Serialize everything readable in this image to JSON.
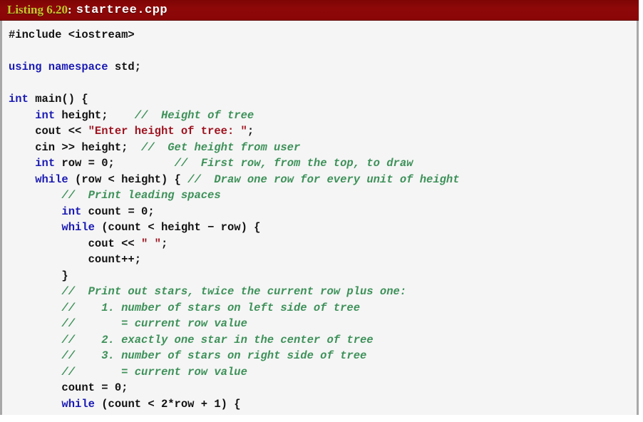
{
  "caption": {
    "listing_number": "Listing 6.20",
    "separator": ":",
    "filename": "startree.cpp"
  },
  "colors": {
    "caption_background": "#8a0707",
    "caption_listing_number": "#c6c82c",
    "caption_filename": "#ffffff",
    "code_background": "#f5f5f5",
    "keyword": "#1a1ab4",
    "string": "#9e1420",
    "comment": "#3d9159",
    "plain": "#111111",
    "border": "#a8a8a8"
  },
  "code": {
    "language": "cpp",
    "lines": [
      [
        {
          "t": "pre",
          "s": "#include <iostream>"
        }
      ],
      [],
      [
        {
          "t": "kw",
          "s": "using namespace"
        },
        {
          "t": "pln",
          "s": " std;"
        }
      ],
      [],
      [
        {
          "t": "kw",
          "s": "int"
        },
        {
          "t": "pln",
          "s": " main() {"
        }
      ],
      [
        {
          "t": "pln",
          "s": "    "
        },
        {
          "t": "kw",
          "s": "int"
        },
        {
          "t": "pln",
          "s": " height;    "
        },
        {
          "t": "cmt",
          "s": "//  Height of tree"
        }
      ],
      [
        {
          "t": "pln",
          "s": "    cout << "
        },
        {
          "t": "str",
          "s": "\"Enter height of tree: \""
        },
        {
          "t": "pln",
          "s": ";"
        }
      ],
      [
        {
          "t": "pln",
          "s": "    cin >> height;  "
        },
        {
          "t": "cmt",
          "s": "//  Get height from user"
        }
      ],
      [
        {
          "t": "pln",
          "s": "    "
        },
        {
          "t": "kw",
          "s": "int"
        },
        {
          "t": "pln",
          "s": " row = 0;         "
        },
        {
          "t": "cmt",
          "s": "//  First row, from the top, to draw"
        }
      ],
      [
        {
          "t": "pln",
          "s": "    "
        },
        {
          "t": "kw",
          "s": "while"
        },
        {
          "t": "pln",
          "s": " (row < height) { "
        },
        {
          "t": "cmt",
          "s": "//  Draw one row for every unit of height"
        }
      ],
      [
        {
          "t": "pln",
          "s": "        "
        },
        {
          "t": "cmt",
          "s": "//  Print leading spaces"
        }
      ],
      [
        {
          "t": "pln",
          "s": "        "
        },
        {
          "t": "kw",
          "s": "int"
        },
        {
          "t": "pln",
          "s": " count = 0;"
        }
      ],
      [
        {
          "t": "pln",
          "s": "        "
        },
        {
          "t": "kw",
          "s": "while"
        },
        {
          "t": "pln",
          "s": " (count < height − row) {"
        }
      ],
      [
        {
          "t": "pln",
          "s": "            cout << "
        },
        {
          "t": "str",
          "s": "\" \""
        },
        {
          "t": "pln",
          "s": ";"
        }
      ],
      [
        {
          "t": "pln",
          "s": "            count++;"
        }
      ],
      [
        {
          "t": "pln",
          "s": "        }"
        }
      ],
      [
        {
          "t": "pln",
          "s": "        "
        },
        {
          "t": "cmt",
          "s": "//  Print out stars, twice the current row plus one:"
        }
      ],
      [
        {
          "t": "pln",
          "s": "        "
        },
        {
          "t": "cmt",
          "s": "//    1. number of stars on left side of tree"
        }
      ],
      [
        {
          "t": "pln",
          "s": "        "
        },
        {
          "t": "cmt",
          "s": "//       = current row value"
        }
      ],
      [
        {
          "t": "pln",
          "s": "        "
        },
        {
          "t": "cmt",
          "s": "//    2. exactly one star in the center of tree"
        }
      ],
      [
        {
          "t": "pln",
          "s": "        "
        },
        {
          "t": "cmt",
          "s": "//    3. number of stars on right side of tree"
        }
      ],
      [
        {
          "t": "pln",
          "s": "        "
        },
        {
          "t": "cmt",
          "s": "//       = current row value"
        }
      ],
      [
        {
          "t": "pln",
          "s": "        count = 0;"
        }
      ],
      [
        {
          "t": "pln",
          "s": "        "
        },
        {
          "t": "kw",
          "s": "while"
        },
        {
          "t": "pln",
          "s": " (count < 2*row + 1) {"
        }
      ]
    ]
  }
}
